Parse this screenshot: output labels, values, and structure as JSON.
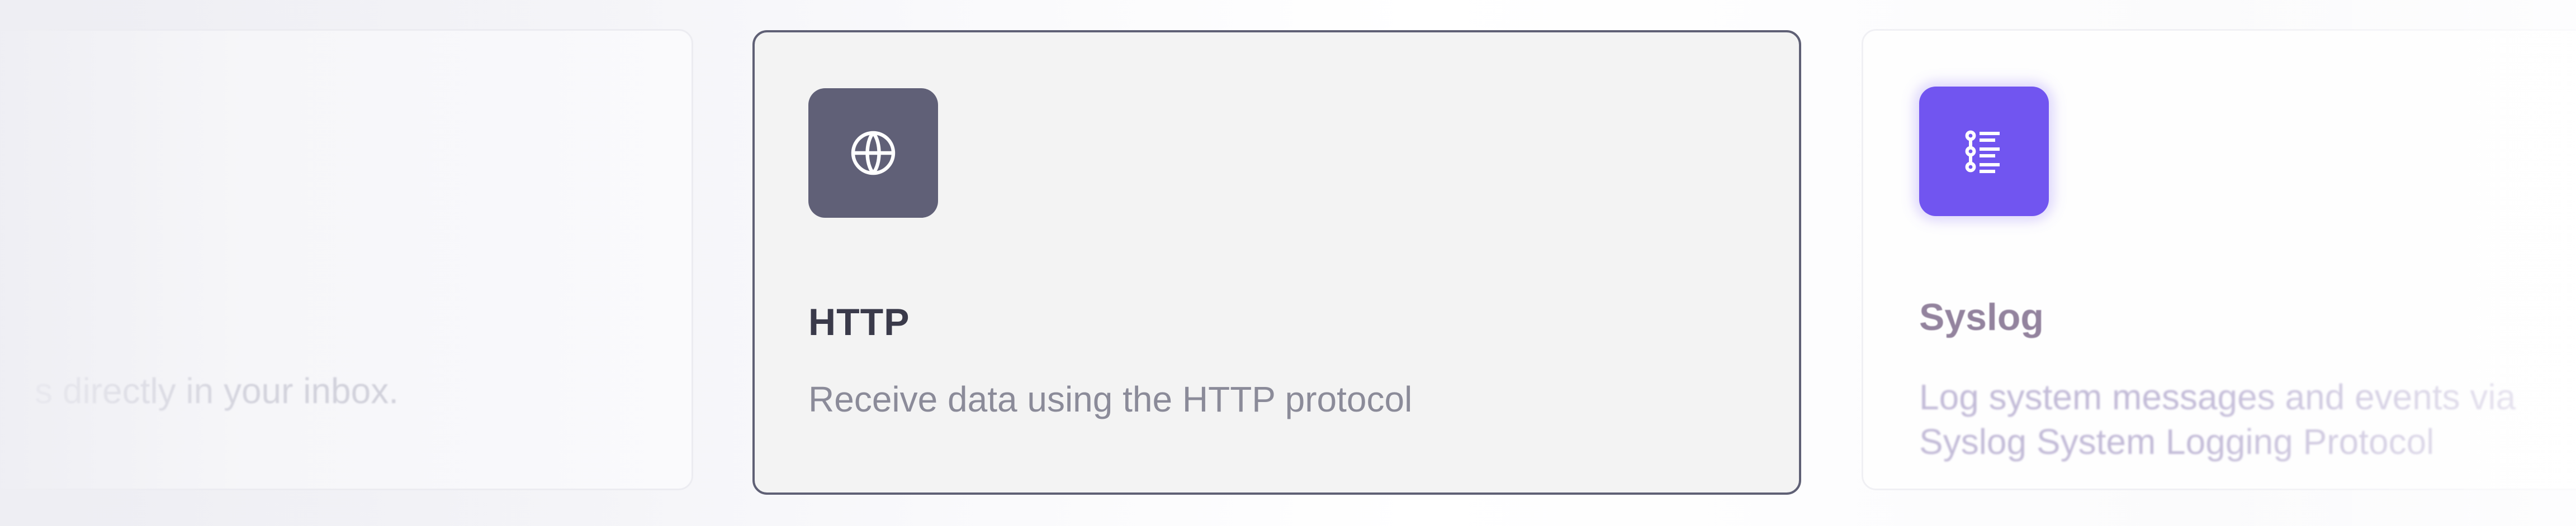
{
  "cards": {
    "left": {
      "description": "s directly in your inbox."
    },
    "http": {
      "title": "HTTP",
      "description": "Receive data using the HTTP protocol",
      "icon": "globe-icon",
      "icon_tile_color": "#606077"
    },
    "syslog": {
      "title": "Syslog",
      "description_line1": "Log system messages and events via",
      "description_line2": "Syslog System Logging Protocol",
      "icon": "list-icon",
      "icon_tile_color": "#6a4df0"
    }
  },
  "colors": {
    "selected_border": "#5f6075",
    "accent_purple": "#6a4df0"
  }
}
